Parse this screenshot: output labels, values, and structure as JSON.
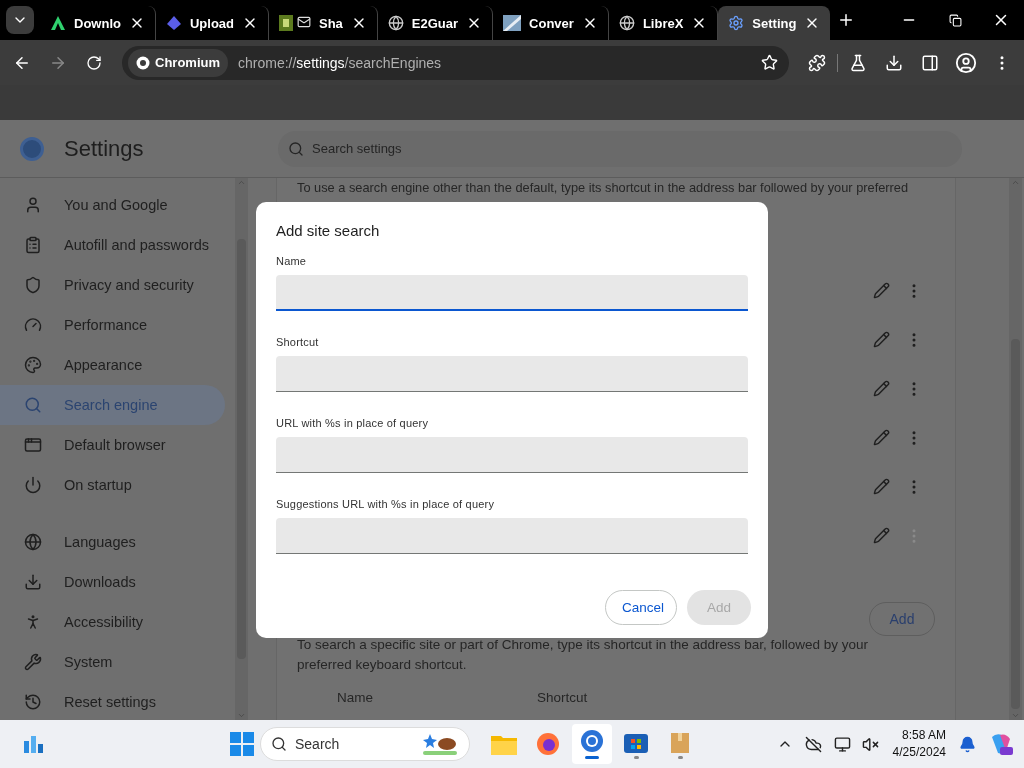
{
  "tabs": [
    {
      "label": "Downlo",
      "kind": "green",
      "selected": false
    },
    {
      "label": "Upload",
      "kind": "purple",
      "selected": false
    },
    {
      "label": "Sha",
      "kind": "badge",
      "selected": false
    },
    {
      "label": "E2Guar",
      "kind": "globe",
      "selected": false
    },
    {
      "label": "Conver",
      "kind": "stripe",
      "selected": false
    },
    {
      "label": "LibreX",
      "kind": "globe",
      "selected": false
    },
    {
      "label": "Setting",
      "kind": "gear",
      "selected": true
    }
  ],
  "toolbar": {
    "chip": "Chromium",
    "url": "chrome://**settings**/searchEngines"
  },
  "header": {
    "title": "Settings",
    "search_placeholder": "Search settings"
  },
  "sidebar": {
    "sections": [
      {
        "items": [
          {
            "label": "You and Google",
            "kind": "person",
            "selected": false
          },
          {
            "label": "Autofill and passwords",
            "kind": "clipboard",
            "selected": false
          },
          {
            "label": "Privacy and security",
            "kind": "shield",
            "selected": false
          },
          {
            "label": "Performance",
            "kind": "gauge",
            "selected": false
          },
          {
            "label": "Appearance",
            "kind": "palette",
            "selected": false
          },
          {
            "label": "Search engine",
            "kind": "search",
            "selected": true
          },
          {
            "label": "Default browser",
            "kind": "browser",
            "selected": false
          },
          {
            "label": "On startup",
            "kind": "power",
            "selected": false
          }
        ]
      },
      {
        "items": [
          {
            "label": "Languages",
            "kind": "globe",
            "selected": false
          },
          {
            "label": "Downloads",
            "kind": "download",
            "selected": false
          },
          {
            "label": "Accessibility",
            "kind": "accessibility",
            "selected": false
          },
          {
            "label": "System",
            "kind": "wrench",
            "selected": false
          },
          {
            "label": "Reset settings",
            "kind": "history",
            "selected": false
          }
        ]
      }
    ]
  },
  "content": {
    "intro": "To use a search engine other than the default, type its shortcut in the address bar followed by your preferred",
    "engine_rows": [
      {
        "menu_disabled": false
      },
      {
        "menu_disabled": false
      },
      {
        "menu_disabled": false
      },
      {
        "menu_disabled": false
      },
      {
        "menu_disabled": false
      },
      {
        "menu_disabled": true
      }
    ],
    "site_search": {
      "button": "Add",
      "text": "To search a specific site or part of Chrome, type its shortcut in the address bar, followed by your preferred keyboard shortcut.",
      "columns": [
        "Name",
        "Shortcut"
      ]
    }
  },
  "dialog": {
    "title": "Add site search",
    "fields": [
      {
        "label": "Name",
        "focused": true
      },
      {
        "label": "Shortcut",
        "focused": false
      },
      {
        "label": "URL with %s in place of query",
        "focused": false
      },
      {
        "label": "Suggestions URL with %s in place of query",
        "focused": false
      }
    ],
    "buttons": [
      {
        "label": "Cancel",
        "disabled": false
      },
      {
        "label": "Add",
        "disabled": true
      }
    ]
  },
  "taskbar": {
    "search_placeholder": "Search",
    "apps": [
      {
        "kind": "folder",
        "running": false,
        "active": false
      },
      {
        "kind": "firefox",
        "running": false,
        "active": false
      },
      {
        "kind": "chromium",
        "running": true,
        "active": true
      },
      {
        "kind": "store",
        "running": true,
        "active": false
      },
      {
        "kind": "box",
        "running": true,
        "active": false
      }
    ],
    "time": "8:58 AM",
    "date": "4/25/2024"
  }
}
